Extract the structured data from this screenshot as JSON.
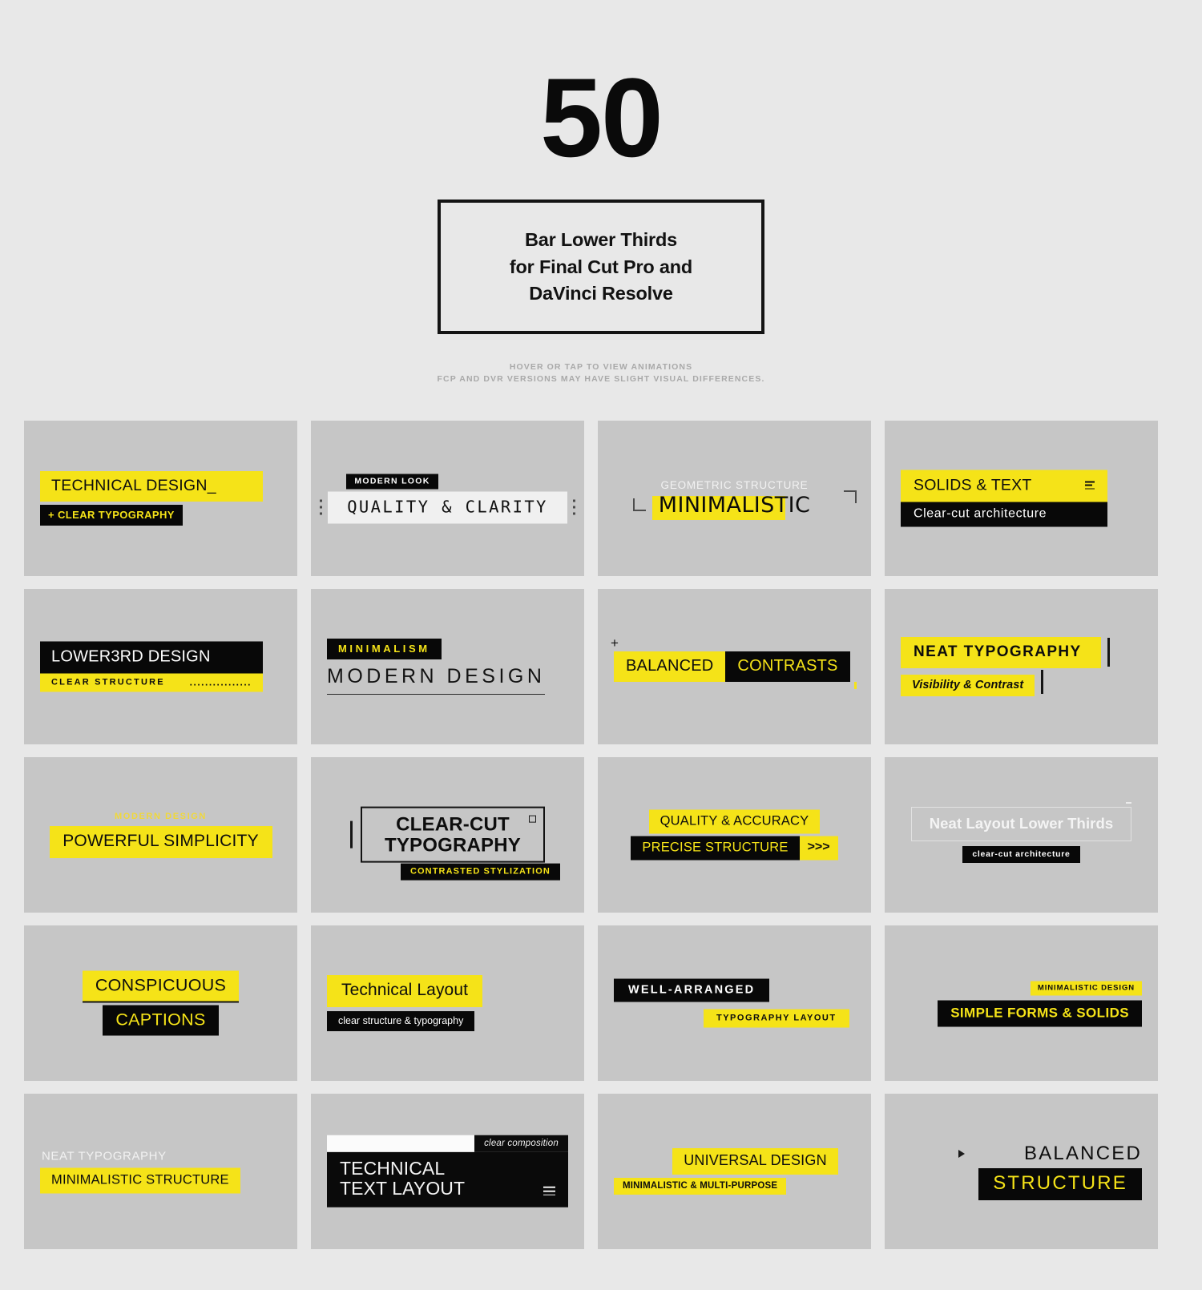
{
  "hero": {
    "number": "50",
    "title_line1": "Bar Lower Thirds",
    "title_line2": "for Final Cut Pro and",
    "title_line3": "DaVinci Resolve",
    "note_line1": "HOVER OR TAP TO VIEW ANIMATIONS",
    "note_line2": "FCP AND DVR VERSIONS MAY HAVE SLIGHT VISUAL DIFFERENCES."
  },
  "colors": {
    "accent_yellow": "#f5e318",
    "black": "#080808",
    "page_background": "#e8e8e8",
    "card_background": "#c6c6c6"
  },
  "cards": [
    {
      "id": "technical-design",
      "primary": "TECHNICAL DESIGN_",
      "secondary": "+ CLEAR TYPOGRAPHY"
    },
    {
      "id": "quality-clarity",
      "primary": "QUALITY & CLARITY",
      "secondary": "MODERN LOOK"
    },
    {
      "id": "minimalistic",
      "primary": "MINIMALISTIC",
      "secondary": "GEOMETRIC STRUCTURE"
    },
    {
      "id": "solids-text",
      "primary": "SOLIDS & TEXT",
      "secondary": "Clear-cut architecture"
    },
    {
      "id": "lower3rd-design",
      "primary": "LOWER3RD DESIGN",
      "secondary": "CLEAR STRUCTURE",
      "tertiary": "................"
    },
    {
      "id": "modern-design",
      "primary": "MODERN DESIGN",
      "secondary": "MINIMALISM"
    },
    {
      "id": "balanced-contrasts",
      "primary": "BALANCED",
      "secondary": "CONTRASTS",
      "tertiary": "+"
    },
    {
      "id": "neat-typography",
      "primary": "NEAT TYPOGRAPHY",
      "secondary": "Visibility & Contrast"
    },
    {
      "id": "powerful-simplicity",
      "primary": "POWERFUL SIMPLICITY",
      "secondary": "MODERN DESIGN"
    },
    {
      "id": "clear-cut-typography",
      "primary": "CLEAR-CUT",
      "secondary": "TYPOGRAPHY",
      "tertiary": "CONTRASTED STYLIZATION"
    },
    {
      "id": "quality-accuracy",
      "primary": "QUALITY & ACCURACY",
      "secondary": "PRECISE STRUCTURE",
      "tertiary": ">>>"
    },
    {
      "id": "neat-layout",
      "primary": "Neat Layout Lower Thirds",
      "secondary": "clear-cut architecture"
    },
    {
      "id": "conspicuous-captions",
      "primary": "CONSPICUOUS",
      "secondary": "CAPTIONS"
    },
    {
      "id": "technical-layout",
      "primary": "Technical Layout",
      "secondary": "clear structure & typography"
    },
    {
      "id": "well-arranged",
      "primary": "WELL-ARRANGED",
      "secondary": "TYPOGRAPHY LAYOUT"
    },
    {
      "id": "simple-forms-solids",
      "primary": "SIMPLE FORMS & SOLIDS",
      "secondary": "MINIMALISTIC DESIGN"
    },
    {
      "id": "minimalistic-structure",
      "primary": "MINIMALISTIC STRUCTURE",
      "secondary": "NEAT TYPOGRAPHY"
    },
    {
      "id": "technical-text-layout",
      "primary": "TECHNICAL",
      "secondary": "TEXT LAYOUT",
      "tertiary": "clear composition"
    },
    {
      "id": "universal-design",
      "primary": "UNIVERSAL DESIGN",
      "secondary": "MINIMALISTIC & MULTI-PURPOSE"
    },
    {
      "id": "balanced-structure",
      "primary": "BALANCED",
      "secondary": "STRUCTURE"
    }
  ]
}
